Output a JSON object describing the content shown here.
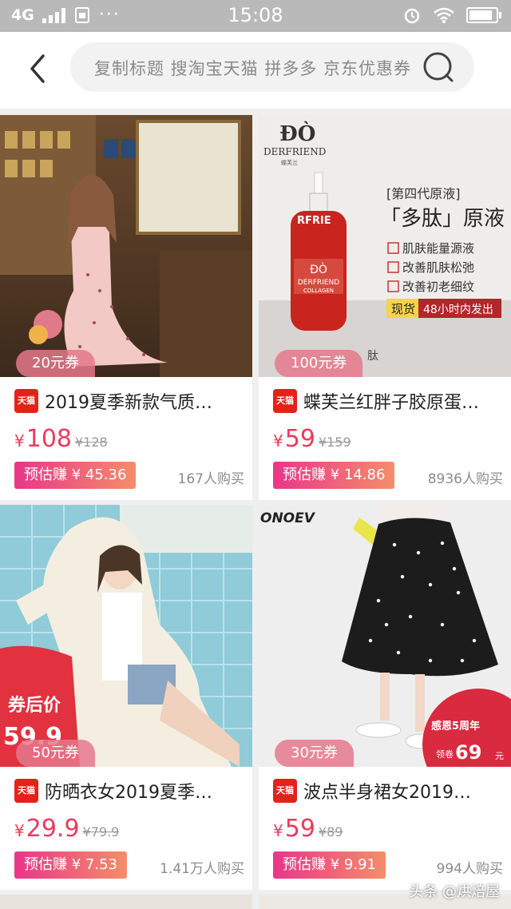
{
  "status_bar": {
    "network": "4G",
    "time": "15:08",
    "icons": [
      "signal-icon",
      "sim-icon",
      "more-icon",
      "alarm-icon",
      "wifi-icon",
      "battery-icon"
    ]
  },
  "search": {
    "placeholder": "复制标题 搜淘宝天猫 拼多多 京东优惠券"
  },
  "products": [
    {
      "coupon": "20元券",
      "tmall_badge": "天猫",
      "title": "2019夏季新款气质…",
      "yen": "¥",
      "price": "108",
      "original_price": "¥128",
      "earn": "预估赚 ¥ 45.36",
      "sold": "167人购买"
    },
    {
      "coupon": "100元券",
      "tmall_badge": "天猫",
      "title": "蝶芙兰红胖子胶原蛋…",
      "yen": "¥",
      "price": "59",
      "original_price": "¥159",
      "earn": "预估赚 ¥ 14.86",
      "sold": "8936人购买",
      "image_text": {
        "brand": "DERFRIEND",
        "brand_sub": "蝶芙兰",
        "gen": "[第四代原液]",
        "headline": "「多肽」原液",
        "bullets": [
          "肌肤能量源液",
          "改善肌肤松弛",
          "改善初老细纹"
        ],
        "stock": "现货",
        "ship": "48小时内发出",
        "bottle_brand": "DERFRIEND",
        "bottle_sub": "COLLAGEN",
        "partial": "肽"
      }
    },
    {
      "coupon": "50元券",
      "tmall_badge": "天猫",
      "title": "防晒衣女2019夏季…",
      "yen": "¥",
      "price": "29.9",
      "original_price": "¥79.9",
      "earn": "预估赚 ¥ 7.53",
      "sold": "1.41万人购买",
      "image_text": {
        "after_coupon": "券后价",
        "after_coupon_price": "59.9"
      }
    },
    {
      "coupon": "30元券",
      "tmall_badge": "天猫",
      "title": "波点半身裙女2019…",
      "yen": "¥",
      "price": "59",
      "original_price": "¥89",
      "earn": "预估赚 ¥ 9.91",
      "sold": "994人购买",
      "image_text": {
        "brand": "ONOEV",
        "promo_line1": "感恩5周年",
        "promo_get": "领卷",
        "promo_price": "69",
        "promo_unit": "元"
      }
    }
  ],
  "watermark": "头条 @烘焙屋",
  "colors": {
    "accent": "#ea3b5b",
    "earn_gradient_start": "#e8368a",
    "earn_gradient_end": "#f58d6a",
    "tmall": "#e2231a"
  }
}
